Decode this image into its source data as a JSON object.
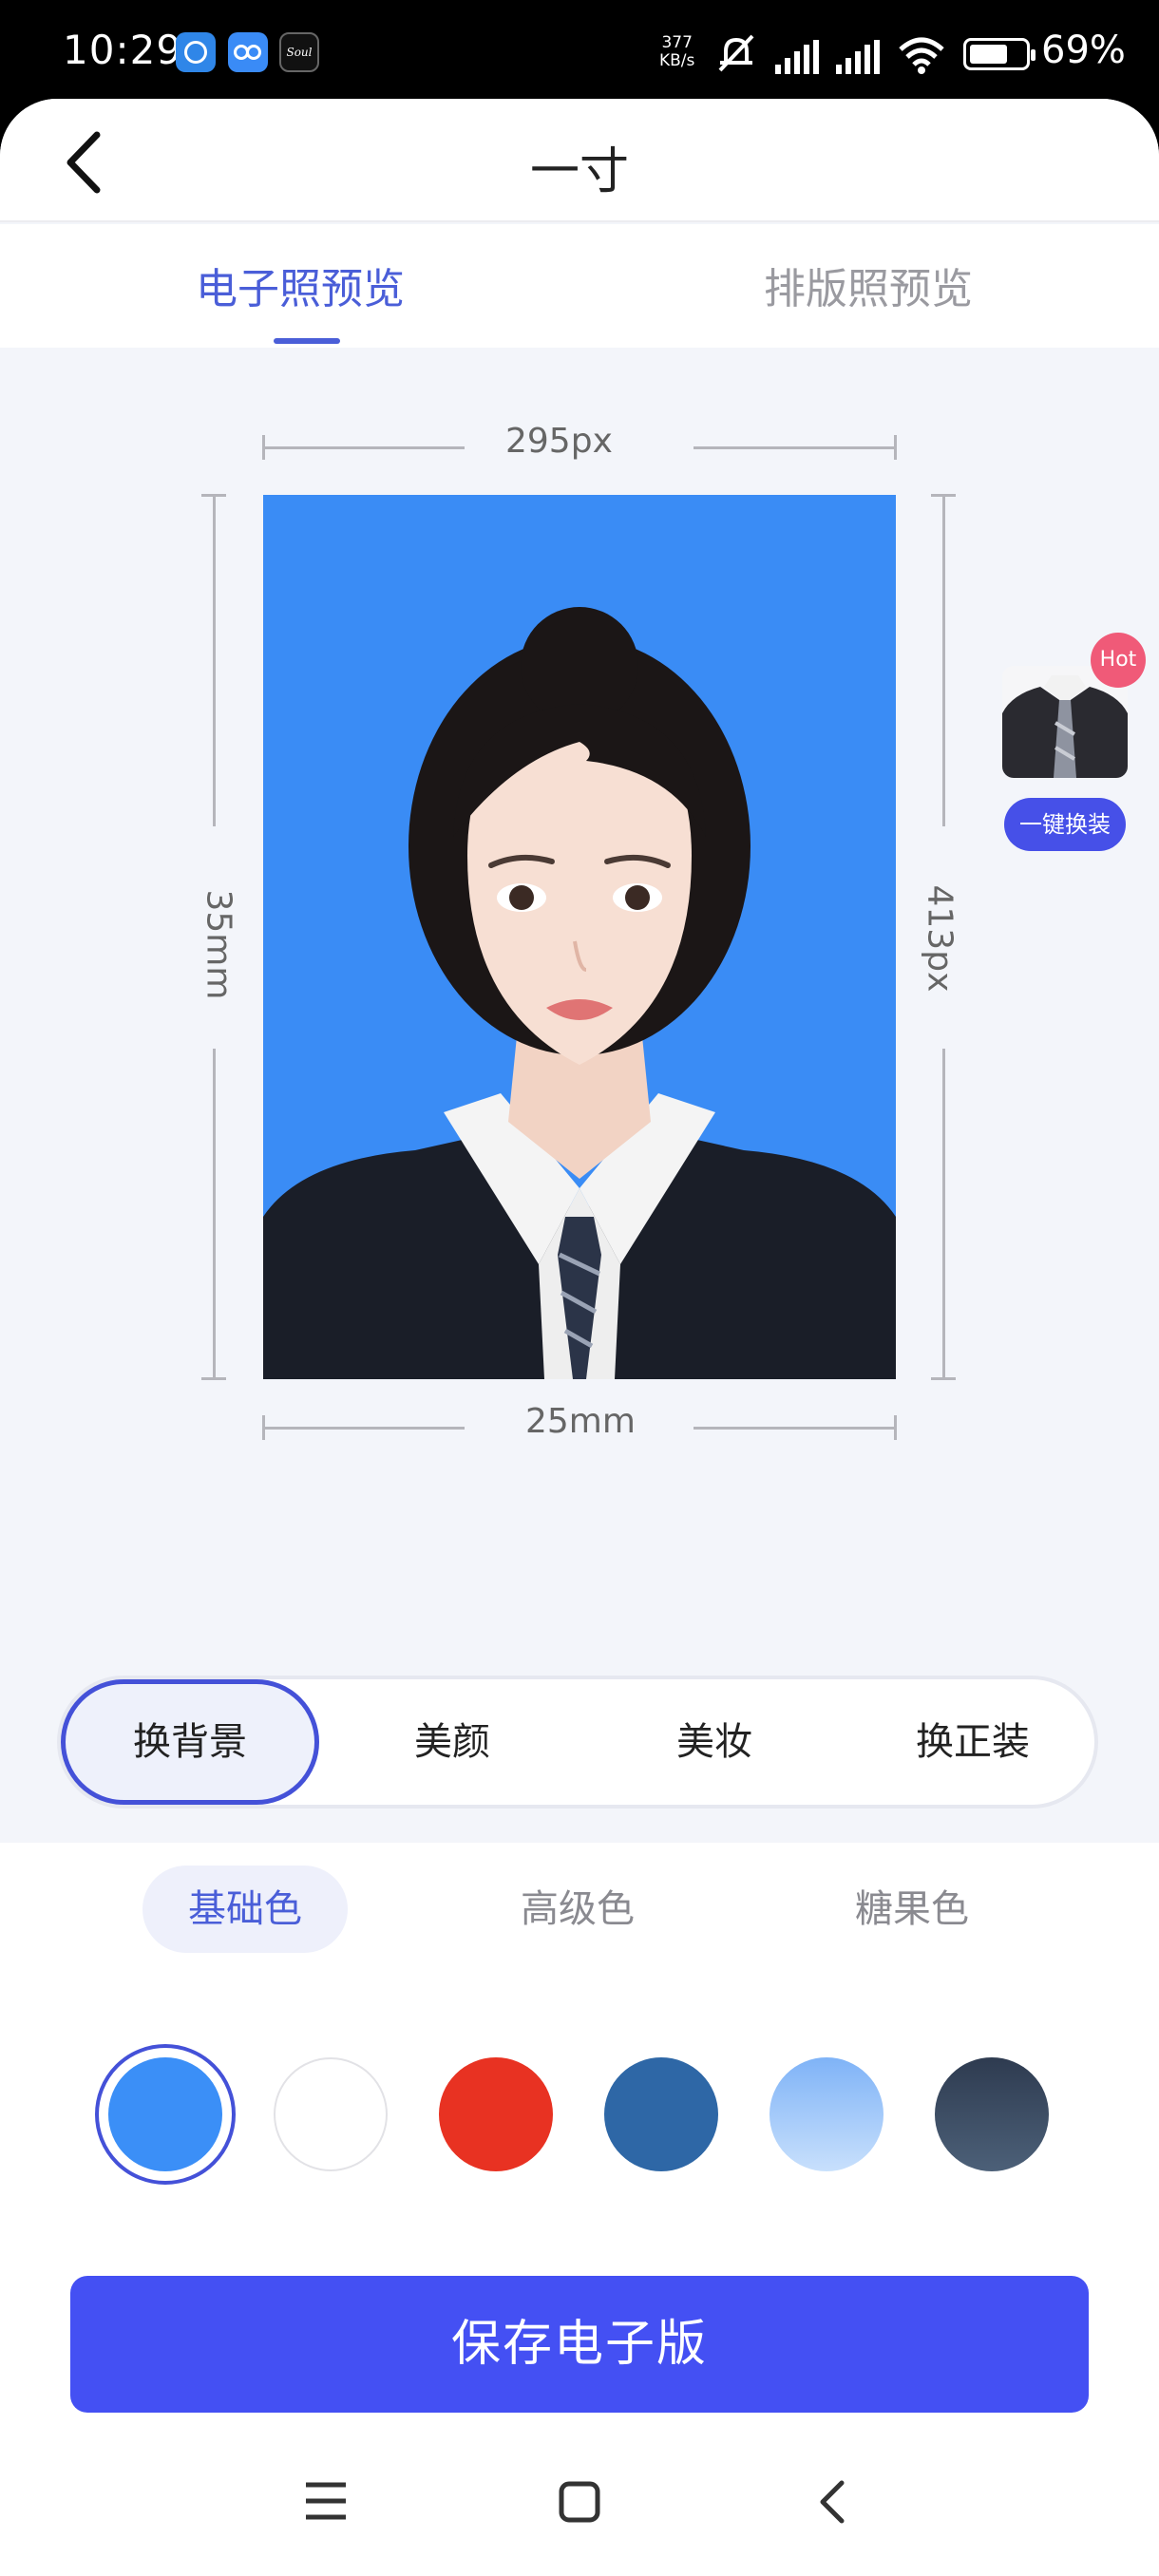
{
  "status_bar": {
    "time": "10:29",
    "speed_value": "377",
    "speed_unit": "KB/s",
    "battery_percent": "69%",
    "battery_level": 0.69
  },
  "header": {
    "title": "一寸"
  },
  "tabs": {
    "active": "电子照预览",
    "inactive": "排版照预览"
  },
  "photo": {
    "width_px": "295px",
    "height_mm": "35mm",
    "height_px": "413px",
    "width_mm": "25mm",
    "background_color": "#3a8cf5"
  },
  "side": {
    "hot_badge": "Hot",
    "oneclick_label": "一键换装"
  },
  "segment": {
    "items": [
      "换背景",
      "美颜",
      "美妆",
      "换正装"
    ],
    "selected": "换背景"
  },
  "color_tabs": {
    "items": [
      "基础色",
      "高级色",
      "糖果色"
    ],
    "selected": "基础色"
  },
  "swatches": [
    {
      "name": "blue",
      "color": "#3b8ff7",
      "selected": true
    },
    {
      "name": "white",
      "color": "#ffffff",
      "selected": false
    },
    {
      "name": "red",
      "color": "#e83222",
      "selected": false
    },
    {
      "name": "dark-blue",
      "color": "#2e67a6",
      "selected": false
    },
    {
      "name": "light-blue-gradient",
      "color": "#8fbff9",
      "selected": false
    },
    {
      "name": "dark-slate-gradient",
      "color": "#34465f",
      "selected": false
    }
  ],
  "save_button": "保存电子版",
  "icons": {
    "back": "back-arrow-icon",
    "nav_menu": "menu-icon",
    "nav_home": "home-icon",
    "nav_back": "back-icon"
  }
}
